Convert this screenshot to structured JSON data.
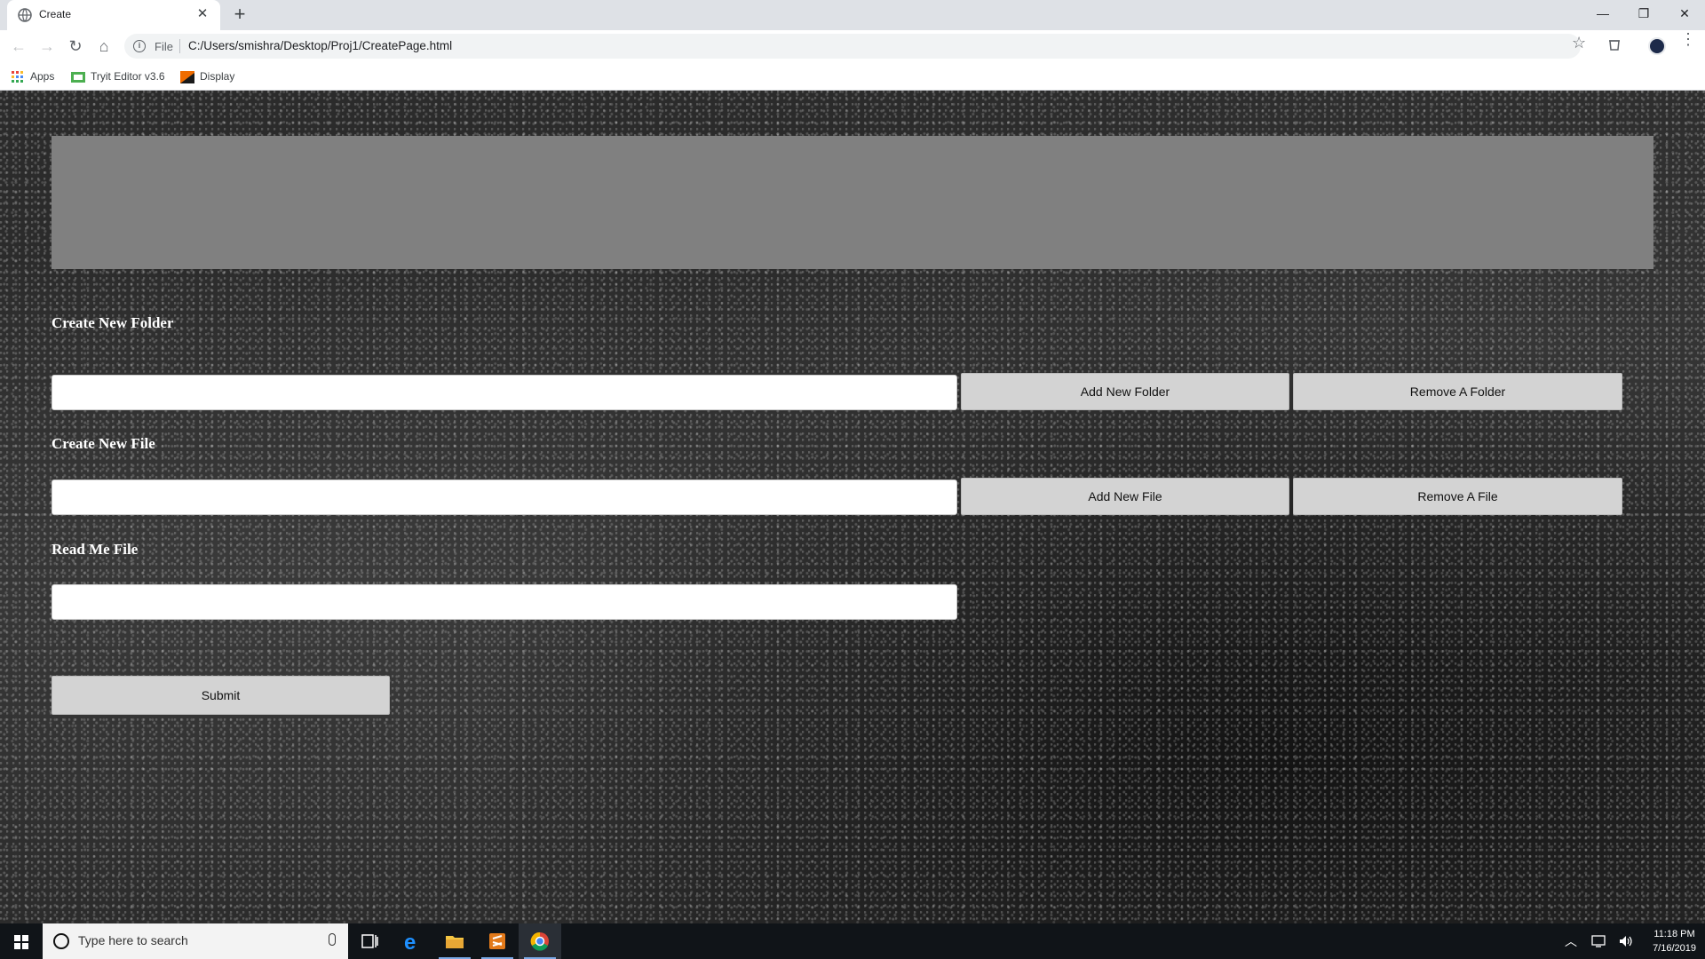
{
  "browser": {
    "tab_title": "Create",
    "address_scheme": "File",
    "address_url": "C:/Users/smishra/Desktop/Proj1/CreatePage.html",
    "bookmarks": [
      "Apps",
      "Tryit Editor v3.6",
      "Display"
    ]
  },
  "page": {
    "folder_section_title": "Create New Folder",
    "add_folder_label": "Add New Folder",
    "remove_folder_label": "Remove A Folder",
    "folder_input_value": "",
    "file_section_title": "Create New File",
    "add_file_label": "Add New File",
    "remove_file_label": "Remove A File",
    "file_input_value": "",
    "readme_section_title": "Read Me File",
    "readme_input_value": "",
    "submit_label": "Submit",
    "colors": {
      "banner": "#808080",
      "button": "#d3d3d3",
      "heading": "#ffffff"
    }
  },
  "taskbar": {
    "search_placeholder": "Type here to search",
    "time": "11:18 PM",
    "date": "7/16/2019"
  }
}
